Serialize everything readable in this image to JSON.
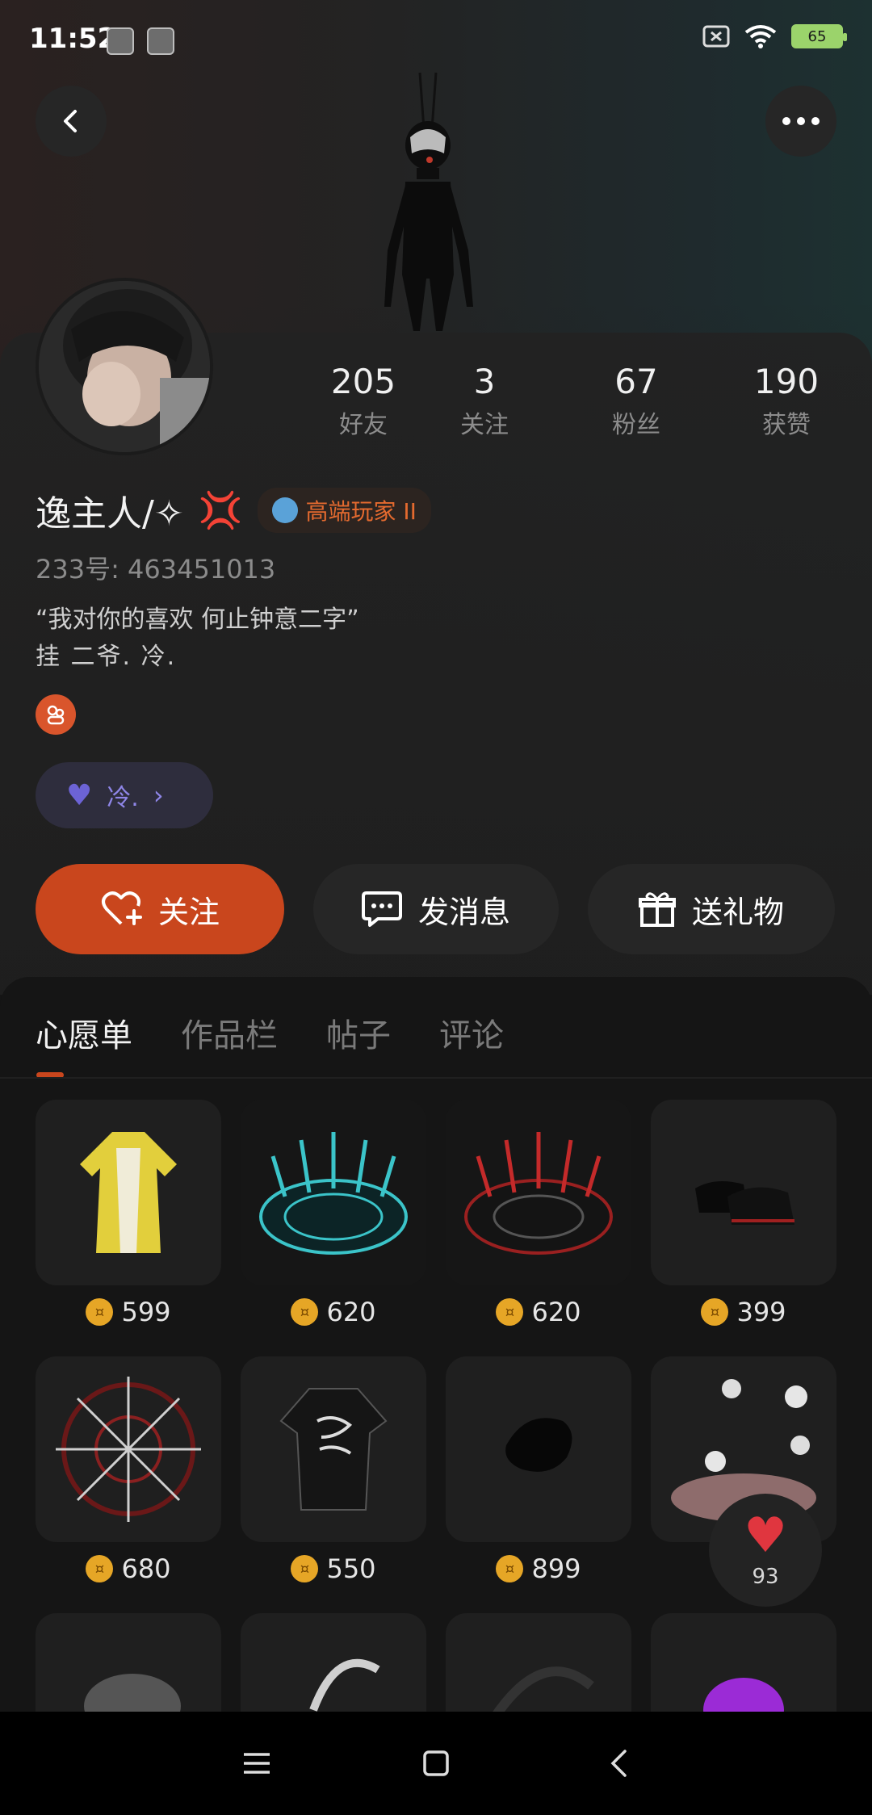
{
  "status_bar": {
    "time": "11:52",
    "battery": "65"
  },
  "profile": {
    "name": "逸主人/✧",
    "name_emoji": "💢",
    "badge": "高端玩家 II",
    "uid": "233号: 463451013",
    "bio_line1": "“我对你的喜欢 何止钟意二字”",
    "bio_line2": "挂  二爷.  冷.",
    "cp_name": "冷.",
    "stats": [
      {
        "value": "205",
        "label": "好友"
      },
      {
        "value": "3",
        "label": "关注"
      },
      {
        "value": "67",
        "label": "粉丝"
      },
      {
        "value": "190",
        "label": "获赞"
      }
    ]
  },
  "actions": {
    "follow": "关注",
    "message": "发消息",
    "gift": "送礼物"
  },
  "tabs": [
    "心愿单",
    "作品栏",
    "帖子",
    "评论"
  ],
  "items": [
    {
      "name": "yellow-robe",
      "price": "599"
    },
    {
      "name": "cyan-magic-circle",
      "price": "620"
    },
    {
      "name": "red-magic-circle",
      "price": "620"
    },
    {
      "name": "black-shoes",
      "price": "399"
    },
    {
      "name": "sword-wheel",
      "price": "680"
    },
    {
      "name": "punk-rock-outfit",
      "price": "550"
    },
    {
      "name": "black-hair",
      "price": "899"
    },
    {
      "name": "sakura-effect",
      "price": ""
    }
  ],
  "like_count": "93",
  "colors": {
    "accent": "#c9461d",
    "coin": "#e6a626",
    "heart": "#e0363f",
    "cp": "#8f86e8"
  }
}
